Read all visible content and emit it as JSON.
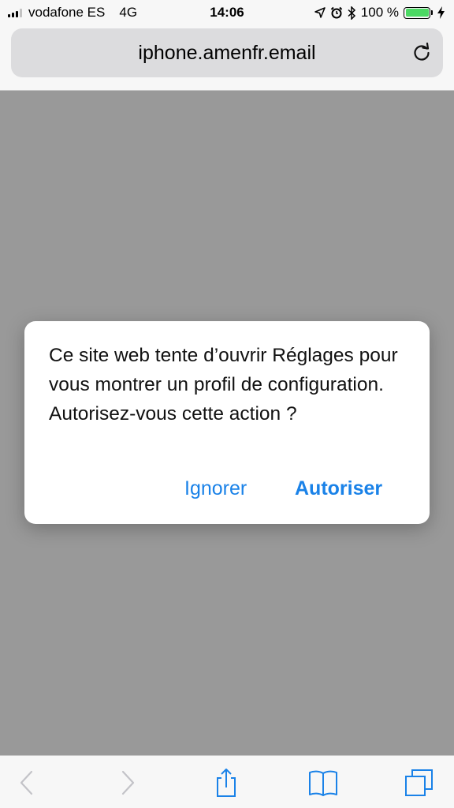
{
  "status_bar": {
    "carrier": "vodafone ES",
    "network": "4G",
    "time": "14:06",
    "battery_percent": "100 %",
    "battery_level": 1.0,
    "signal_bars_filled": 3,
    "signal_bars_total": 4,
    "icons": [
      "location-icon",
      "alarm-icon",
      "bluetooth-icon",
      "charging-bolt-icon"
    ]
  },
  "url_bar": {
    "url": "iphone.amenfr.email",
    "reload_icon": "reload-icon"
  },
  "alert": {
    "message": "Ce site web tente d’ouvrir Réglages pour vous montrer un profil de configuration. Autorisez-vous cette action ?",
    "ignore_label": "Ignorer",
    "allow_label": "Autoriser"
  },
  "toolbar": {
    "icons": [
      "back-icon",
      "forward-icon",
      "share-icon",
      "bookmarks-icon",
      "tabs-icon"
    ]
  },
  "colors": {
    "accent": "#1a82e8",
    "dim_overlay": "#999999",
    "battery": "#4cd964"
  }
}
